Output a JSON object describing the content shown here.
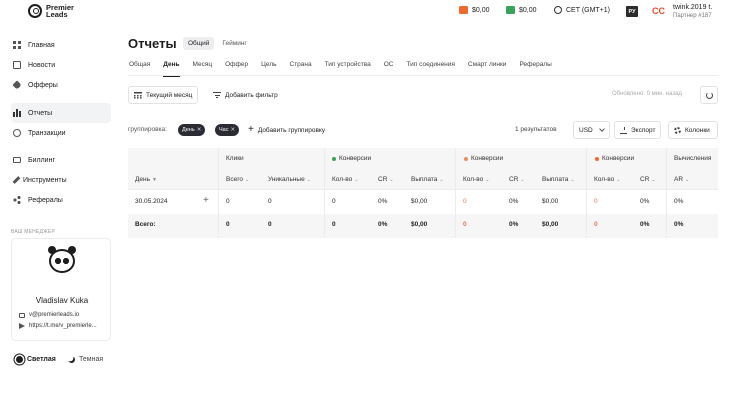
{
  "header": {
    "logo_text": "Premier\nLeads",
    "balance_orange": "$0,00",
    "balance_green": "$0,00",
    "timezone": "CET (GMT+1)",
    "lang": "РУ",
    "user_name": "twink.2019 t.",
    "user_sub": "Партнер #187"
  },
  "sidebar": {
    "items": [
      {
        "label": "Главная",
        "icon": "home-grid-icon"
      },
      {
        "label": "Новости",
        "icon": "news-icon"
      },
      {
        "label": "Офферы",
        "icon": "tag-icon"
      },
      {
        "label": "Отчеты",
        "icon": "bar-chart-icon",
        "active": true
      },
      {
        "label": "Транзакции",
        "icon": "transactions-icon"
      },
      {
        "label": "Биллинг",
        "icon": "billing-card-icon"
      },
      {
        "label": "Инструменты",
        "icon": "tools-icon"
      },
      {
        "label": "Рефералы",
        "icon": "referrals-icon"
      }
    ],
    "manager_label": "ВАШ МЕНЕДЖЕР",
    "manager_name": "Vladislav Kuka",
    "manager_email": "v@premierleads.io",
    "manager_telegram": "https://t.me/v_premierle...",
    "theme_light": "Светлая",
    "theme_dark": "Темная"
  },
  "main": {
    "title": "Отчеты",
    "segments": [
      "Общий",
      "Гейминг"
    ],
    "tabs": [
      "Общая",
      "День",
      "Месяц",
      "Оффер",
      "Цель",
      "Страна",
      "Тип устройства",
      "ОС",
      "Тип соединения",
      "Смарт линки",
      "Рефералы"
    ],
    "active_tab": "День",
    "period_button": "Текущий месяц",
    "add_filter": "Добавить фильтр",
    "updated": "Обновлено: 0 мин. назад",
    "grouping_label": "группировка:",
    "chips": [
      "День",
      "Час"
    ],
    "add_grouping": "Добавить группировку",
    "results": "1  результатов",
    "currency": "USD",
    "export": "Экспорт",
    "columns": "Колонки"
  },
  "table": {
    "groups": {
      "clicks": "Клики",
      "conv1": "Конверсии",
      "conv2": "Конверсии",
      "conv3": "Конверсии",
      "calc": "Вычисления"
    },
    "group_colors": {
      "conv1": "#3aa25a",
      "conv2": "#f08a5d",
      "conv3": "#ef6a2c"
    },
    "headers": {
      "day": "День",
      "total": "Всего",
      "unique": "Уникальные",
      "count": "Кол-во",
      "cr": "CR",
      "payout": "Выплата",
      "ar": "AR"
    },
    "rows": [
      {
        "day": "30.05.2024",
        "total": "0",
        "unique": "0",
        "c1_count": "0",
        "c1_cr": "0%",
        "c1_pay": "$0,00",
        "c2_count": "0",
        "c2_cr": "0%",
        "c2_pay": "$0,00",
        "c3_count": "0",
        "c3_cr": "0%",
        "ar": "0%"
      }
    ],
    "totals": {
      "label": "Всего:",
      "total": "0",
      "unique": "0",
      "c1_count": "0",
      "c1_cr": "0%",
      "c1_pay": "$0,00",
      "c2_count": "0",
      "c2_cr": "0%",
      "c2_pay": "$0,00",
      "c3_count": "0",
      "c3_cr": "0%",
      "ar": "0%"
    }
  }
}
